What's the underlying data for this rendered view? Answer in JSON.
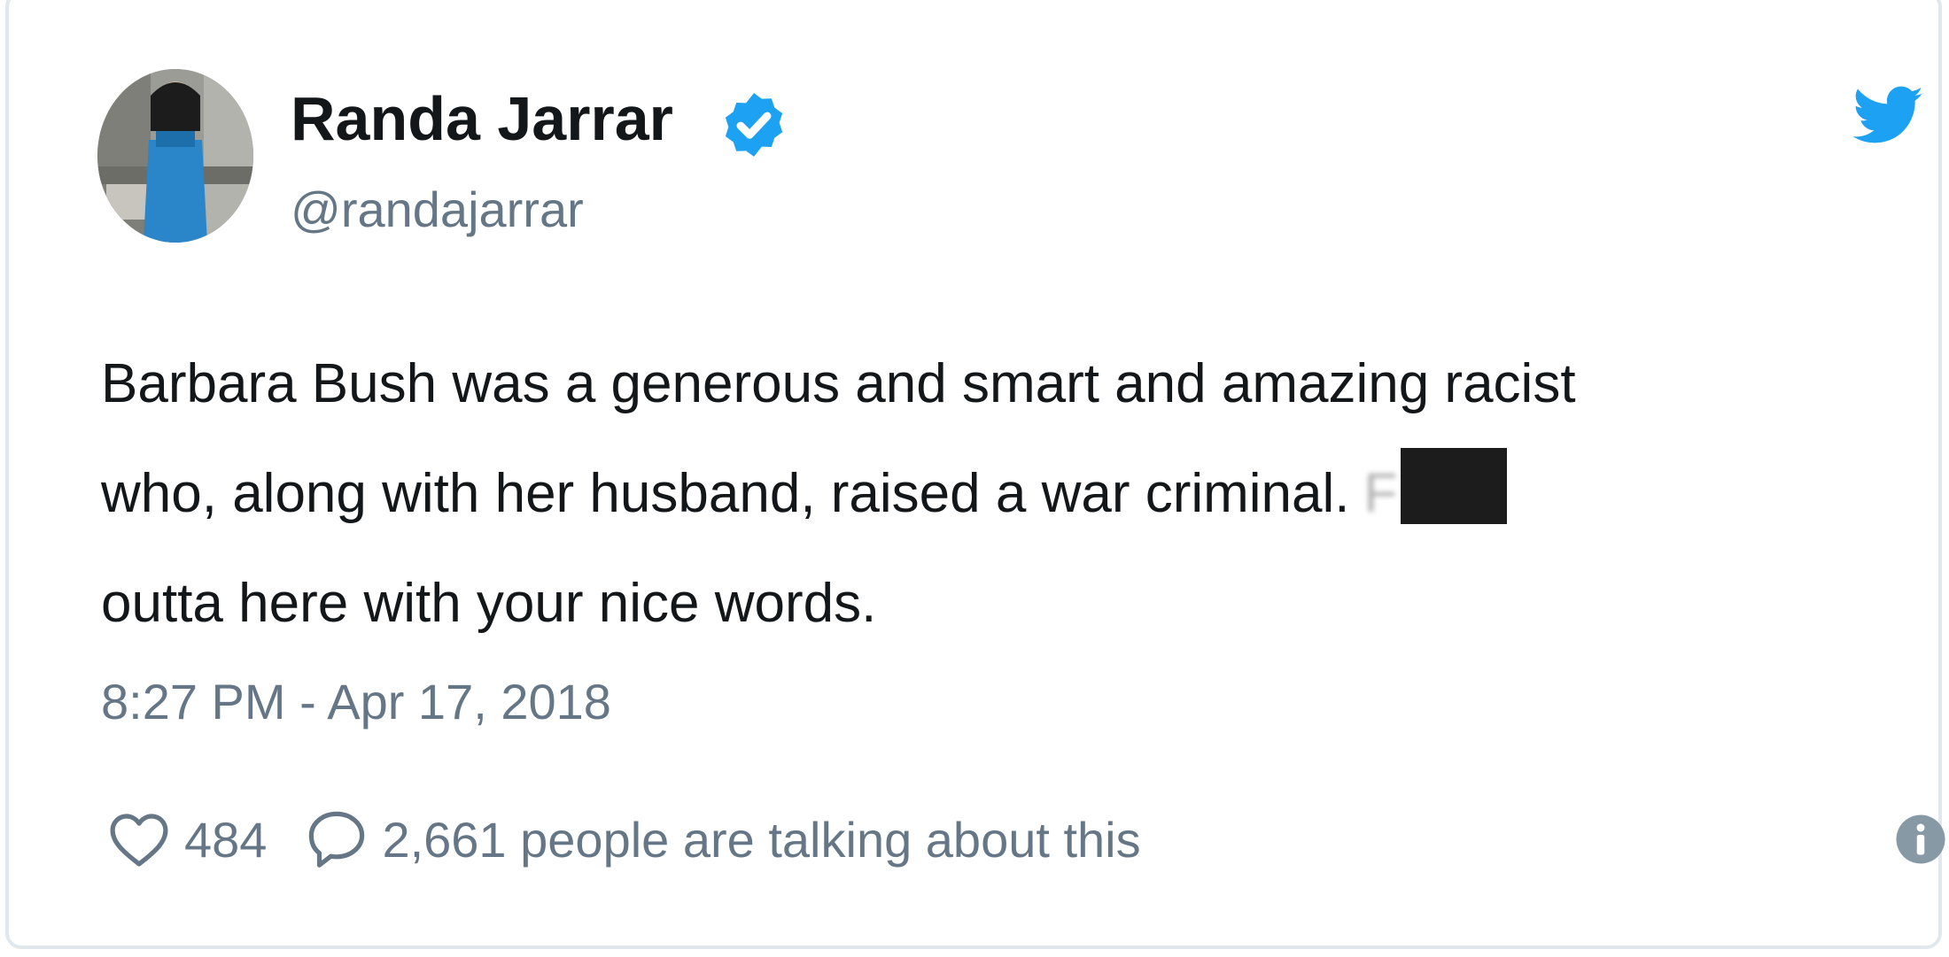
{
  "author": {
    "name": "Randa Jarrar",
    "handle": "@randajarrar",
    "avatar_icon": "profile-photo",
    "verified_icon": "verified-badge-icon"
  },
  "tweet": {
    "line1": "Barbara Bush was a generous and smart and amazing racist",
    "line2": "who, along with her husband, raised a war criminal.",
    "redacted_letter": "F",
    "line3": "outta here with your nice words.",
    "timestamp": "8:27 PM - Apr 17, 2018"
  },
  "actions": {
    "likes": "484",
    "talking": "2,661 people are talking about this",
    "like_icon": "heart-icon",
    "reply_icon": "speech-bubble-icon",
    "info_icon": "info-icon"
  },
  "brand": {
    "logo_icon": "twitter-bird-icon",
    "color": "#1da1f2"
  }
}
